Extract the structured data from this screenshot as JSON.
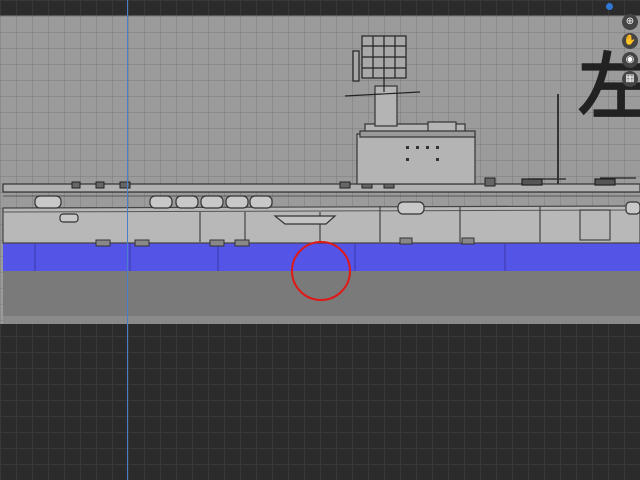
{
  "canvas": {
    "overlay_character": "左"
  },
  "toolbar": {
    "tools": [
      {
        "name": "zoom-in-icon",
        "glyph": "⊕"
      },
      {
        "name": "hand-pan-icon",
        "glyph": "✋"
      },
      {
        "name": "camera-icon",
        "glyph": "◉"
      },
      {
        "name": "grid-toggle-icon",
        "glyph": "▦"
      }
    ]
  },
  "colors": {
    "waterline": "#5454e6",
    "canvas_bg": "#9b9b9b",
    "selection_circle": "#e01818",
    "guide_line": "#4a7ec8",
    "workspace_bg": "#2b2b2b"
  }
}
